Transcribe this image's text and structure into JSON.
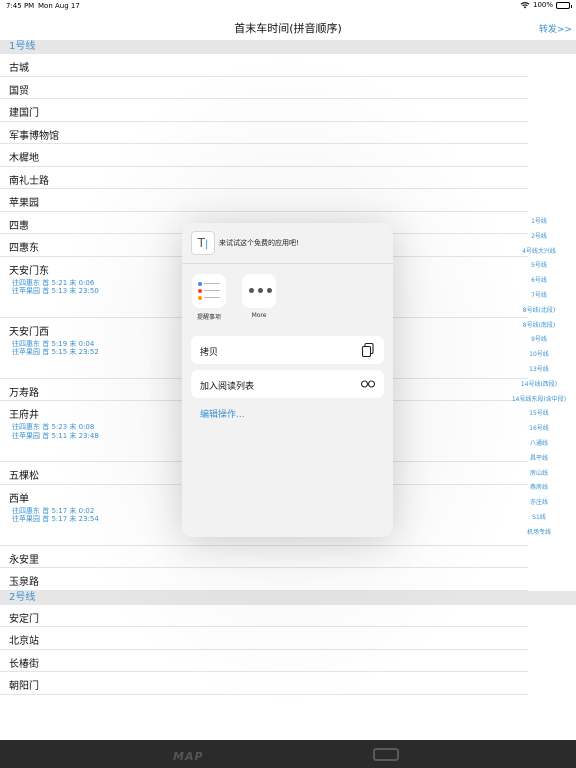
{
  "status": {
    "time": "7:45 PM",
    "date": "Mon Aug 17",
    "battery": "100%"
  },
  "nav": {
    "title": "首末车时间(拼音顺序)",
    "forward": "转发>>"
  },
  "sections": [
    {
      "header": "1号线",
      "stations": [
        {
          "name": "古城"
        },
        {
          "name": "国贸"
        },
        {
          "name": "建国门"
        },
        {
          "name": "军事博物馆"
        },
        {
          "name": "木樨地"
        },
        {
          "name": "南礼士路"
        },
        {
          "name": "苹果园"
        },
        {
          "name": "四惠"
        },
        {
          "name": "四惠东"
        },
        {
          "name": "天安门东",
          "times": [
            "往四惠东 首 5:21 末 0:06",
            "往苹果园 首 5:13 末 23:50"
          ]
        },
        {
          "name": "天安门西",
          "times": [
            "往四惠东 首 5:19 末 0:04",
            "往苹果园 首 5:15 末 23:52"
          ]
        },
        {
          "name": "万寿路"
        },
        {
          "name": "王府井",
          "times": [
            "往四惠东 首 5:23 末 0:08",
            "往苹果园 首 5:11 末 23:48"
          ]
        },
        {
          "name": "五棵松"
        },
        {
          "name": "西单",
          "times": [
            "往四惠东 首 5:17 末 0:02",
            "往苹果园 首 5:17 末 23:54"
          ]
        },
        {
          "name": "永安里"
        },
        {
          "name": "玉泉路"
        }
      ]
    },
    {
      "header": "2号线",
      "stations": [
        {
          "name": "安定门"
        },
        {
          "name": "北京站"
        },
        {
          "name": "长椿街"
        },
        {
          "name": "朝阳门"
        }
      ]
    }
  ],
  "index": [
    "1号线",
    "2号线",
    "4号线大兴线",
    "5号线",
    "6号线",
    "7号线",
    "8号线(北段)",
    "8号线(南段)",
    "9号线",
    "10号线",
    "13号线",
    "14号线(西段)",
    "14号线东段(含中段)",
    "15号线",
    "16号线",
    "八通线",
    "昌平线",
    "房山线",
    "燕房线",
    "亦庄线",
    "S1线",
    "机场专线"
  ],
  "share": {
    "preview_text": "来试试这个免费的应用吧!",
    "apps": [
      {
        "label": "提醒事项",
        "icon": "reminders-icon"
      },
      {
        "label": "More",
        "icon": "more-icon"
      }
    ],
    "actions": [
      {
        "label": "拷贝",
        "icon": "copy-icon"
      },
      {
        "label": "加入阅读列表",
        "icon": "glasses-icon"
      }
    ],
    "edit_actions": "编辑操作..."
  },
  "bottom": {
    "map_label": "MAP"
  },
  "colors": {
    "accent": "#3a92d0",
    "section_bg": "#e6e6e6",
    "bottom_bar": "#2b2b2b"
  }
}
